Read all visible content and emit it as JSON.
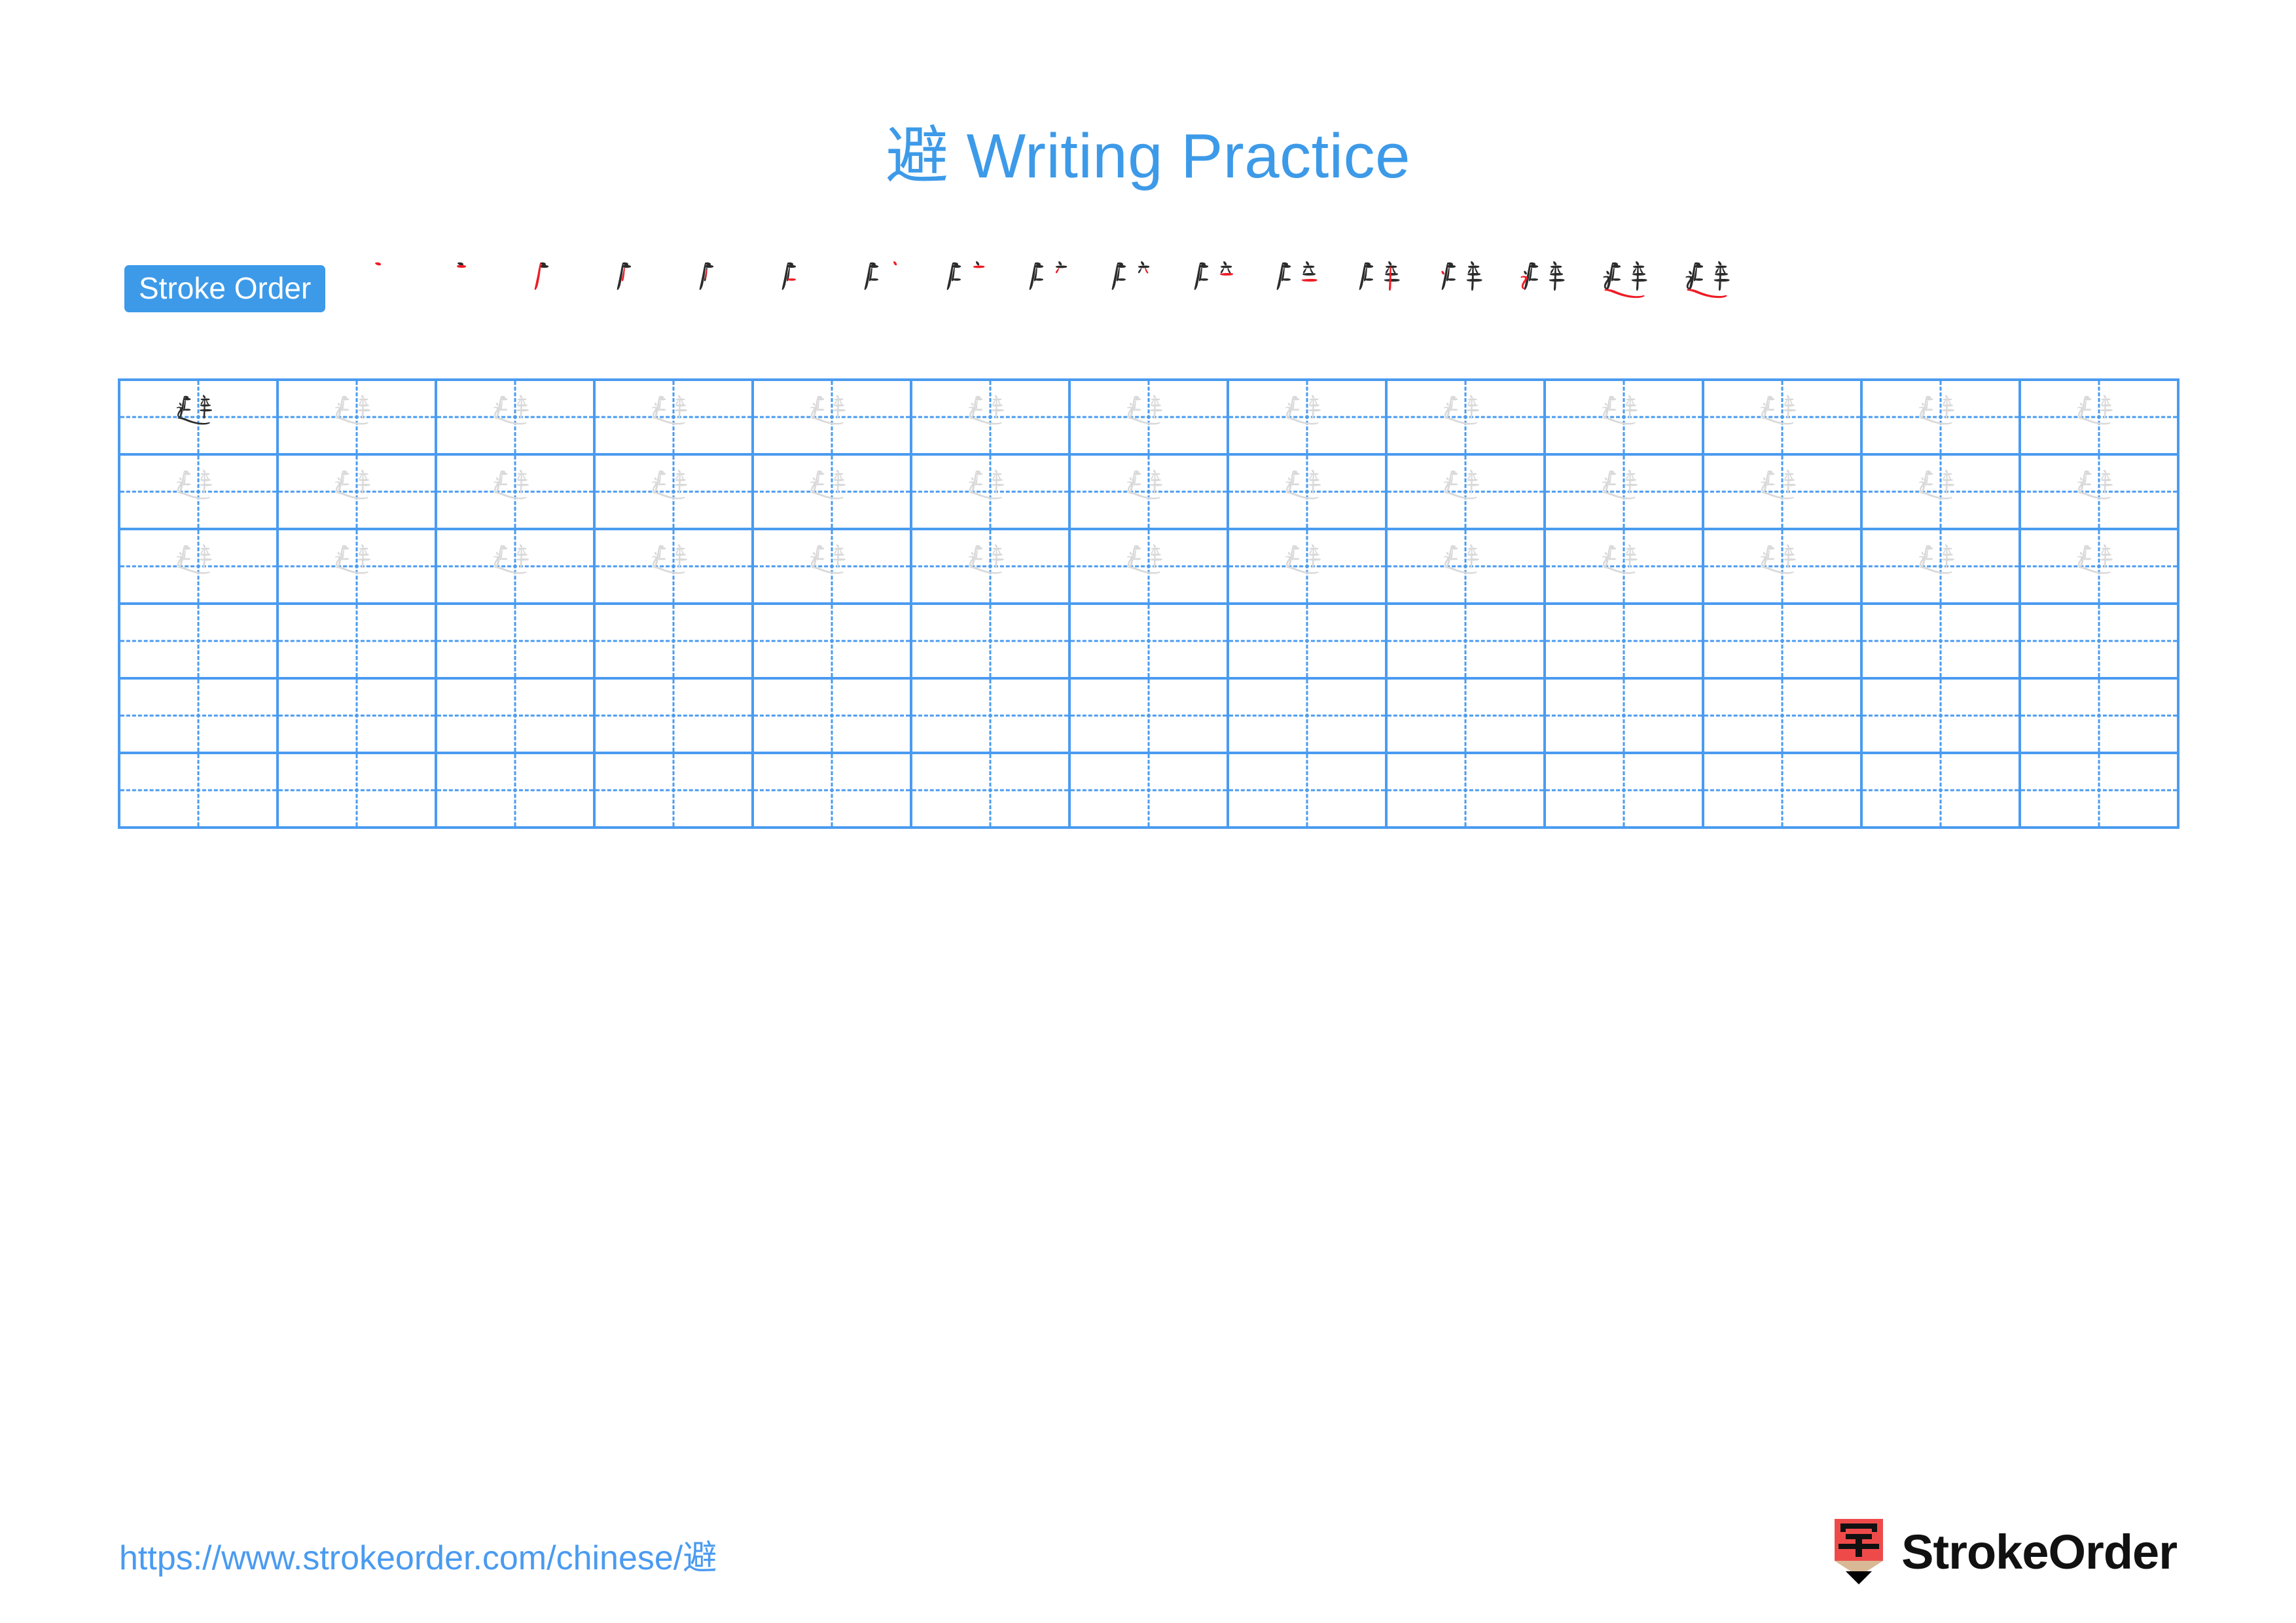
{
  "page": {
    "character": "避",
    "title": "避 Writing Practice",
    "accent_color": "#3d9ae8",
    "grid_line_color": "#4a9bf0",
    "guide_glyph_color": "#d9d9d9",
    "ink_color": "#2b2b2b",
    "highlight_color": "#ee1c25",
    "background": "#ffffff"
  },
  "stroke_order": {
    "label": "Stroke Order",
    "total_strokes": 17,
    "steps": [
      {
        "index": 1,
        "strokes_drawn": 1,
        "new_stroke_color": "#ee1c25"
      },
      {
        "index": 2,
        "strokes_drawn": 2,
        "new_stroke_color": "#ee1c25"
      },
      {
        "index": 3,
        "strokes_drawn": 3,
        "new_stroke_color": "#ee1c25"
      },
      {
        "index": 4,
        "strokes_drawn": 4,
        "new_stroke_color": "#ee1c25"
      },
      {
        "index": 5,
        "strokes_drawn": 5,
        "new_stroke_color": "#ee1c25"
      },
      {
        "index": 6,
        "strokes_drawn": 6,
        "new_stroke_color": "#ee1c25"
      },
      {
        "index": 7,
        "strokes_drawn": 7,
        "new_stroke_color": "#ee1c25"
      },
      {
        "index": 8,
        "strokes_drawn": 8,
        "new_stroke_color": "#ee1c25"
      },
      {
        "index": 9,
        "strokes_drawn": 9,
        "new_stroke_color": "#ee1c25"
      },
      {
        "index": 10,
        "strokes_drawn": 10,
        "new_stroke_color": "#ee1c25"
      },
      {
        "index": 11,
        "strokes_drawn": 11,
        "new_stroke_color": "#ee1c25"
      },
      {
        "index": 12,
        "strokes_drawn": 12,
        "new_stroke_color": "#ee1c25"
      },
      {
        "index": 13,
        "strokes_drawn": 13,
        "new_stroke_color": "#ee1c25"
      },
      {
        "index": 14,
        "strokes_drawn": 14,
        "new_stroke_color": "#ee1c25"
      },
      {
        "index": 15,
        "strokes_drawn": 15,
        "new_stroke_color": "#ee1c25"
      },
      {
        "index": 16,
        "strokes_drawn": 16,
        "new_stroke_color": "#ee1c25"
      },
      {
        "index": 17,
        "strokes_drawn": 17,
        "new_stroke_color": "#ee1c25"
      }
    ]
  },
  "practice_grid": {
    "columns": 13,
    "rows": 6,
    "rows_data": [
      {
        "row": 1,
        "cells": [
          "dark",
          "guide",
          "guide",
          "guide",
          "guide",
          "guide",
          "guide",
          "guide",
          "guide",
          "guide",
          "guide",
          "guide",
          "guide"
        ]
      },
      {
        "row": 2,
        "cells": [
          "guide",
          "guide",
          "guide",
          "guide",
          "guide",
          "guide",
          "guide",
          "guide",
          "guide",
          "guide",
          "guide",
          "guide",
          "guide"
        ]
      },
      {
        "row": 3,
        "cells": [
          "guide",
          "guide",
          "guide",
          "guide",
          "guide",
          "guide",
          "guide",
          "guide",
          "guide",
          "guide",
          "guide",
          "guide",
          "guide"
        ]
      },
      {
        "row": 4,
        "cells": [
          "empty",
          "empty",
          "empty",
          "empty",
          "empty",
          "empty",
          "empty",
          "empty",
          "empty",
          "empty",
          "empty",
          "empty",
          "empty"
        ]
      },
      {
        "row": 5,
        "cells": [
          "empty",
          "empty",
          "empty",
          "empty",
          "empty",
          "empty",
          "empty",
          "empty",
          "empty",
          "empty",
          "empty",
          "empty",
          "empty"
        ]
      },
      {
        "row": 6,
        "cells": [
          "empty",
          "empty",
          "empty",
          "empty",
          "empty",
          "empty",
          "empty",
          "empty",
          "empty",
          "empty",
          "empty",
          "empty",
          "empty"
        ]
      }
    ]
  },
  "footer": {
    "url": "https://www.strokeorder.com/chinese/避",
    "brand_name": "StrokeOrder",
    "brand_icon_character": "字",
    "brand_icon_body_color": "#ef4a4a",
    "brand_icon_wood_color": "#d9b896",
    "brand_icon_tip_color": "#000000"
  }
}
